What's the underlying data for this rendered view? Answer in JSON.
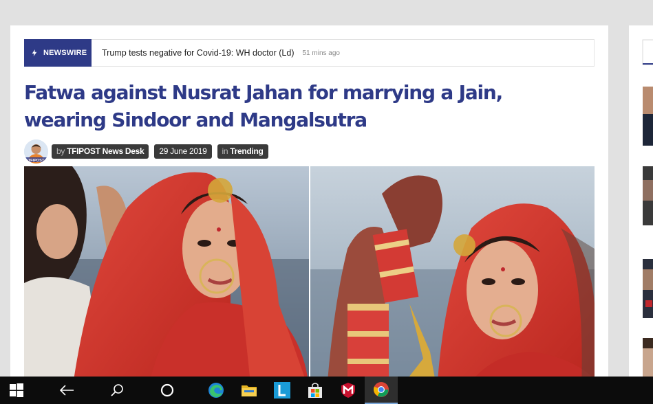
{
  "newswire": {
    "label": "NEWSWIRE",
    "headline": "Trump tests negative for Covid-19: WH doctor (Ld)",
    "time": "51 mins ago"
  },
  "article": {
    "title": "Fatwa against Nusrat Jahan for marrying a Jain, wearing Sindoor and Mangalsutra",
    "by_prefix": "by",
    "author": "TFIPOST News Desk",
    "date": "29 June 2019",
    "in_prefix": "in",
    "category": "Trending",
    "avatar_text": "TFIPOST"
  },
  "colors": {
    "brand": "#2e3a87",
    "pill": "#3a3a3a",
    "taskbar": "#0c0c0c"
  },
  "taskbar": {
    "items": [
      "windows-start-icon",
      "back-arrow-icon",
      "search-icon",
      "cortana-circle-icon",
      "edge-icon",
      "file-explorer-icon",
      "l-app-icon",
      "store-icon",
      "mcafee-icon",
      "chrome-icon"
    ]
  }
}
